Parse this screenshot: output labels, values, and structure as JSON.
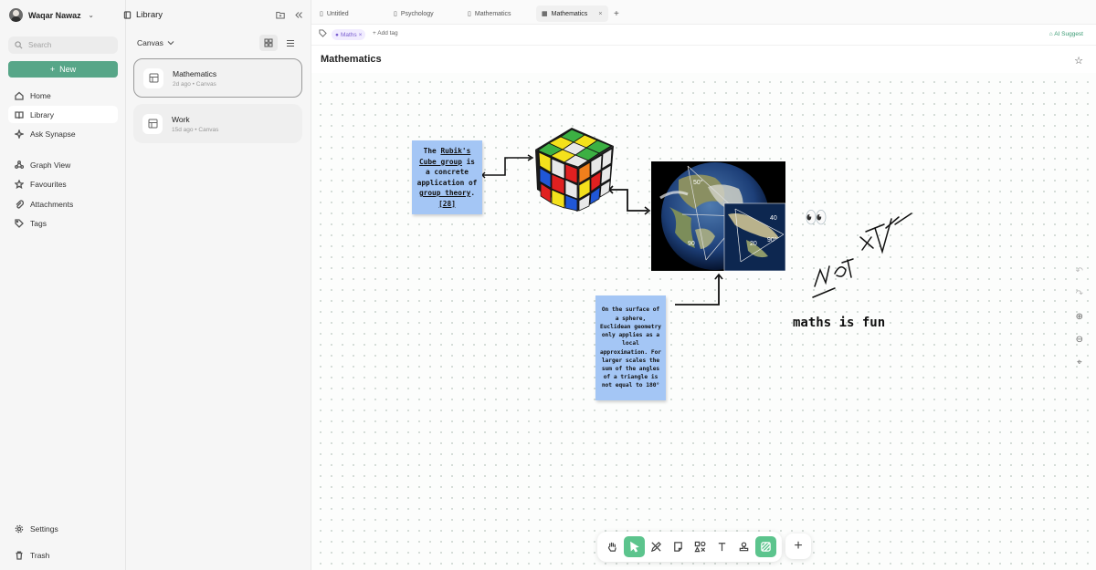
{
  "user": {
    "name": "Waqar Nawaz"
  },
  "sidebar": {
    "search_placeholder": "Search",
    "new_label": "New",
    "items": [
      {
        "label": "Home",
        "icon": "home-icon"
      },
      {
        "label": "Library",
        "icon": "book-icon",
        "active": true
      },
      {
        "label": "Ask Synapse",
        "icon": "sparkle-icon"
      },
      {
        "label": "Graph View",
        "icon": "graph-icon"
      },
      {
        "label": "Favourites",
        "icon": "star-icon"
      },
      {
        "label": "Attachments",
        "icon": "paperclip-icon"
      },
      {
        "label": "Tags",
        "icon": "tag-icon"
      }
    ],
    "settings_label": "Settings",
    "trash_label": "Trash"
  },
  "library": {
    "title": "Library",
    "filter": "Canvas",
    "items": [
      {
        "title": "Mathematics",
        "meta": "2d ago • Canvas",
        "selected": true
      },
      {
        "title": "Work",
        "meta": "15d ago • Canvas",
        "selected": false
      }
    ]
  },
  "tabs": [
    {
      "label": "Untitled",
      "icon": "document-icon"
    },
    {
      "label": "Psychology",
      "icon": "document-icon"
    },
    {
      "label": "Mathematics",
      "icon": "document-icon"
    },
    {
      "label": "Mathematics",
      "icon": "canvas-icon",
      "active": true,
      "close": "×"
    }
  ],
  "tags": {
    "items": [
      "Maths"
    ],
    "add_label": "Add tag",
    "ai_suggest": "AI Suggest"
  },
  "document": {
    "title": "Mathematics"
  },
  "canvas": {
    "note1": {
      "prefix": "The ",
      "link1": "Rubik's Cube group",
      "middle": " is a concrete application of ",
      "link2": "group theory",
      "suffix": ". ",
      "ref": "[28]"
    },
    "note2": "On the surface of a sphere, Euclidean geometry only applies as a local approximation. For larger scales the sum of the angles of a triangle is not equal to 180°",
    "handwriting": "maths is fun",
    "globe_labels": [
      "50°",
      "40",
      "90",
      "90°",
      "20"
    ],
    "emoji": "👀"
  },
  "toolbar": {
    "tools": [
      "hand-icon",
      "pointer-icon",
      "pen-icon",
      "sticky-note-icon",
      "shapes-icon",
      "text-icon",
      "stamp-icon",
      "hatch-icon"
    ],
    "active_tool": "pointer-icon",
    "add_label": "+"
  },
  "colors": {
    "accent": "#57a688",
    "note": "#a4c6f5",
    "tag": "#7a5fd0"
  }
}
